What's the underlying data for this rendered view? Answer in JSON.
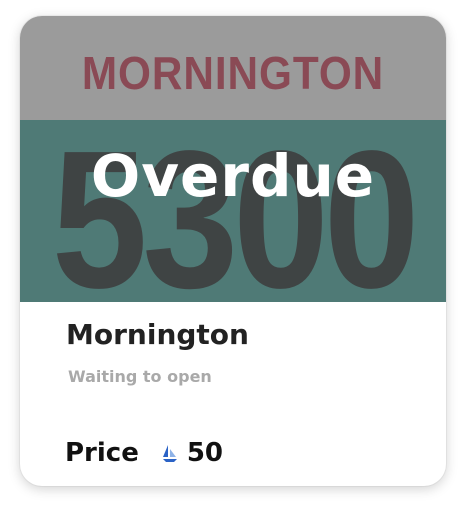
{
  "card": {
    "banner": {
      "word": "MORNINGTON",
      "number": "5300",
      "status": "Overdue"
    },
    "title": "Mornington",
    "subtitle": "Waiting to open",
    "price": {
      "label": "Price",
      "value": "50",
      "icon": "sailboat-coin-icon"
    }
  },
  "colors": {
    "banner_top": "#9b9b9b",
    "banner_bottom": "#4f7a76",
    "banner_word": "#8a4a55",
    "banner_number": "#3f4444",
    "status_text": "#ffffff",
    "coin_primary": "#2b63c6",
    "coin_secondary": "#8fb3e8"
  }
}
